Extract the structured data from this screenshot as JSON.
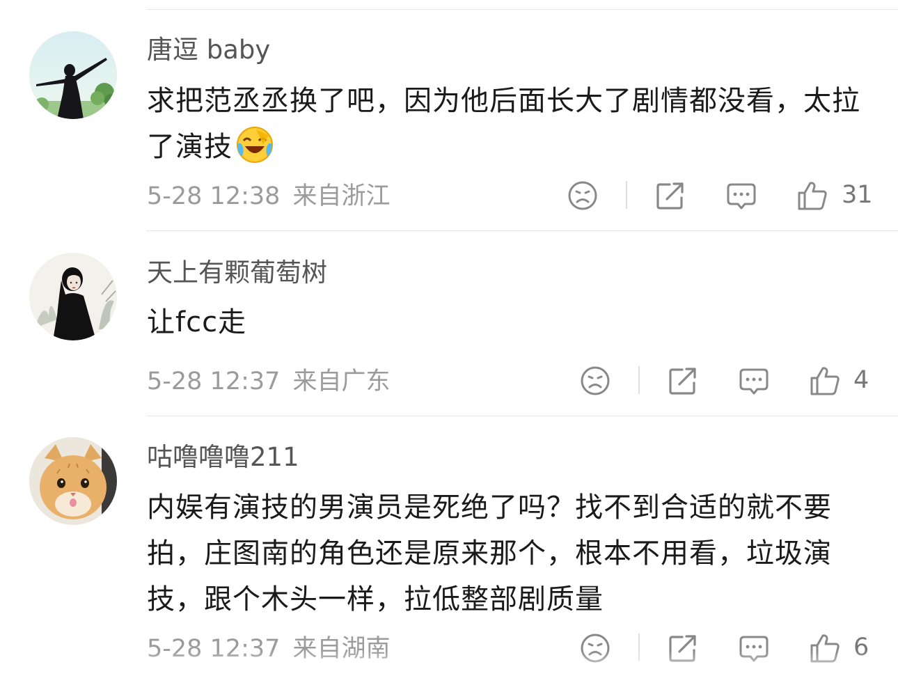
{
  "comments": [
    {
      "username": "唐逗 baby",
      "text": "求把范丞丞换了吧，因为他后面长大了剧情都没看，太拉了演技",
      "emoji": "laughing-crying-emoji",
      "time": "5-28 12:38",
      "location": "来自浙江",
      "likes": "31",
      "avatar_icon": "avatar-woman-arms-outstretched"
    },
    {
      "username": "天上有颗葡萄树",
      "text": "让fcc走",
      "time": "5-28 12:37",
      "location": "来自广东",
      "likes": "4",
      "avatar_icon": "avatar-illustrated-girl"
    },
    {
      "username": "咕噜噜噜211",
      "text": "内娱有演技的男演员是死绝了吗？找不到合适的就不要拍，庄图南的角色还是原来那个，根本不用看，垃圾演技，跟个木头一样，拉低整部剧质量",
      "time": "5-28 12:37",
      "location": "来自湖南",
      "likes": "6",
      "avatar_icon": "avatar-orange-cat"
    }
  ],
  "icons": {
    "dislike": "sad-face-icon",
    "share": "share-icon",
    "reply": "comment-bubble-icon",
    "like": "thumbs-up-icon"
  },
  "colors": {
    "username": "#555555",
    "text": "#1a1a1a",
    "meta": "#9b9b9b",
    "icon": "#888888"
  }
}
